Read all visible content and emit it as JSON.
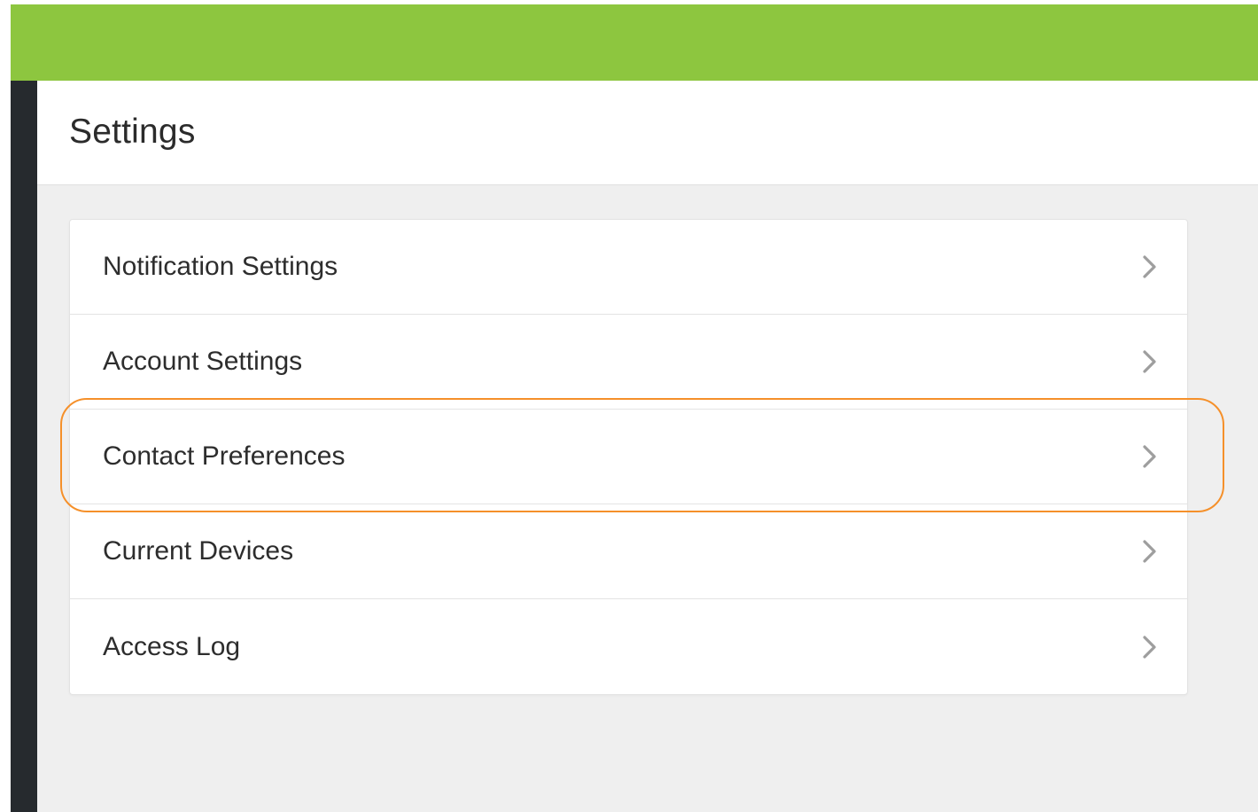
{
  "header": {
    "title": "Settings"
  },
  "settings": {
    "items": [
      {
        "label": "Notification Settings",
        "icon": "chevron-right-icon"
      },
      {
        "label": "Account Settings",
        "icon": "chevron-right-icon"
      },
      {
        "label": "Contact Preferences",
        "icon": "chevron-right-icon",
        "highlighted": true
      },
      {
        "label": "Current Devices",
        "icon": "chevron-right-icon"
      },
      {
        "label": "Access Log",
        "icon": "chevron-right-icon"
      }
    ]
  },
  "colors": {
    "topbar": "#8dc63f",
    "sidebar": "#262a2e",
    "content_background": "#efefef",
    "highlight_outline": "#f5902a",
    "text": "#2d2d2d",
    "chevron": "#9e9e9e"
  }
}
